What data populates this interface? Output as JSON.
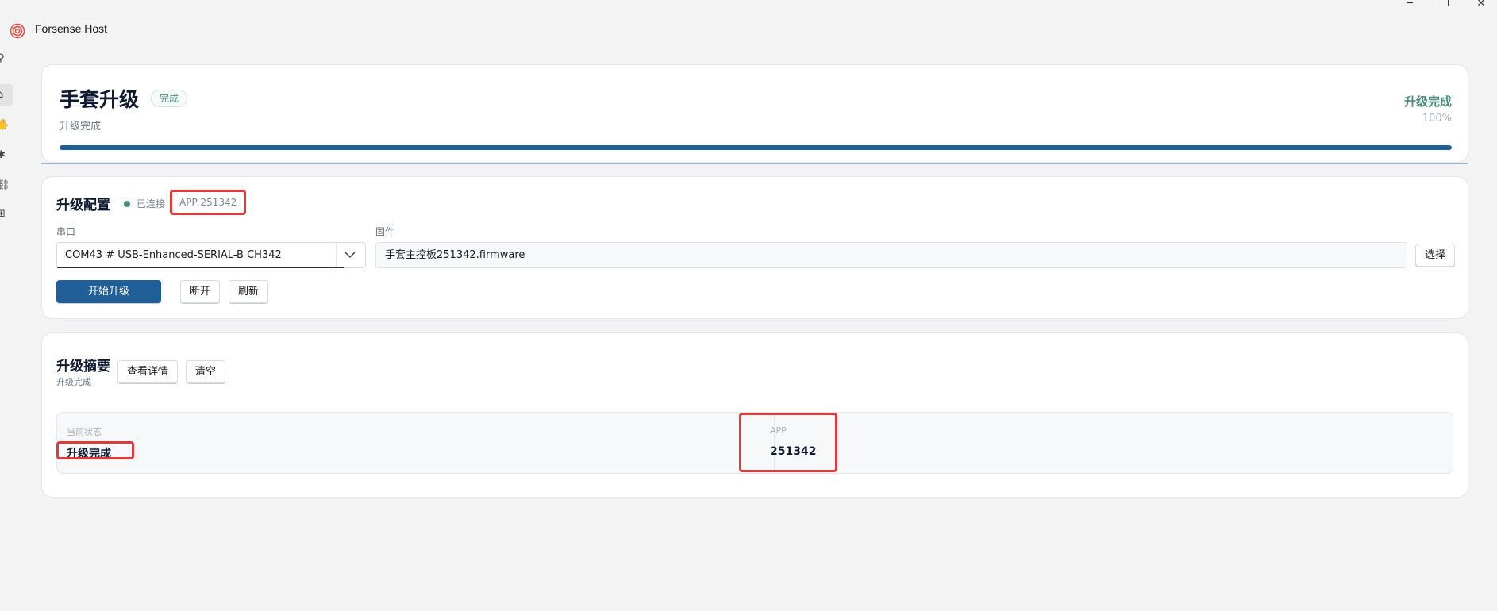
{
  "window": {
    "title": "Forsense Host",
    "controls": {
      "minimize": "─",
      "maximize": "❐",
      "close": "✕"
    }
  },
  "nav": {
    "items": [
      {
        "icon": "user-icon",
        "glyph": "⚲"
      },
      {
        "icon": "home-icon",
        "glyph": "⌂",
        "active": true
      },
      {
        "icon": "hand-icon",
        "glyph": "✋"
      },
      {
        "icon": "settings-icon",
        "glyph": "✱"
      },
      {
        "icon": "link-icon",
        "glyph": "⛓"
      },
      {
        "icon": "grid-icon",
        "glyph": "⊞"
      }
    ]
  },
  "header": {
    "title": "手套升级",
    "badge": "完成",
    "subtitle": "升级完成",
    "progress_label": "升级完成",
    "progress_percent_text": "100%",
    "progress_value": 1.0
  },
  "config": {
    "title": "升级配置",
    "connection_status": "已连接",
    "app_version_badge": "APP 251342",
    "serial_label": "串口",
    "serial_value": "COM43 # USB-Enhanced-SERIAL-B CH342",
    "firmware_label": "固件",
    "firmware_value": "手套主控板251342.firmware",
    "select_button": "选择",
    "start_button": "开始升级",
    "disconnect_button": "断开",
    "refresh_button": "刷新"
  },
  "summary": {
    "title": "升级摘要",
    "subtitle": "升级完成",
    "details_button": "查看详情",
    "clear_button": "清空",
    "current_status_label": "当前状态",
    "current_status_value": "升级完成",
    "app_label": "APP",
    "app_value": "251342"
  },
  "colors": {
    "accent": "#1f5e96",
    "success": "#4b8c7b",
    "highlight": "#e23a3a"
  }
}
